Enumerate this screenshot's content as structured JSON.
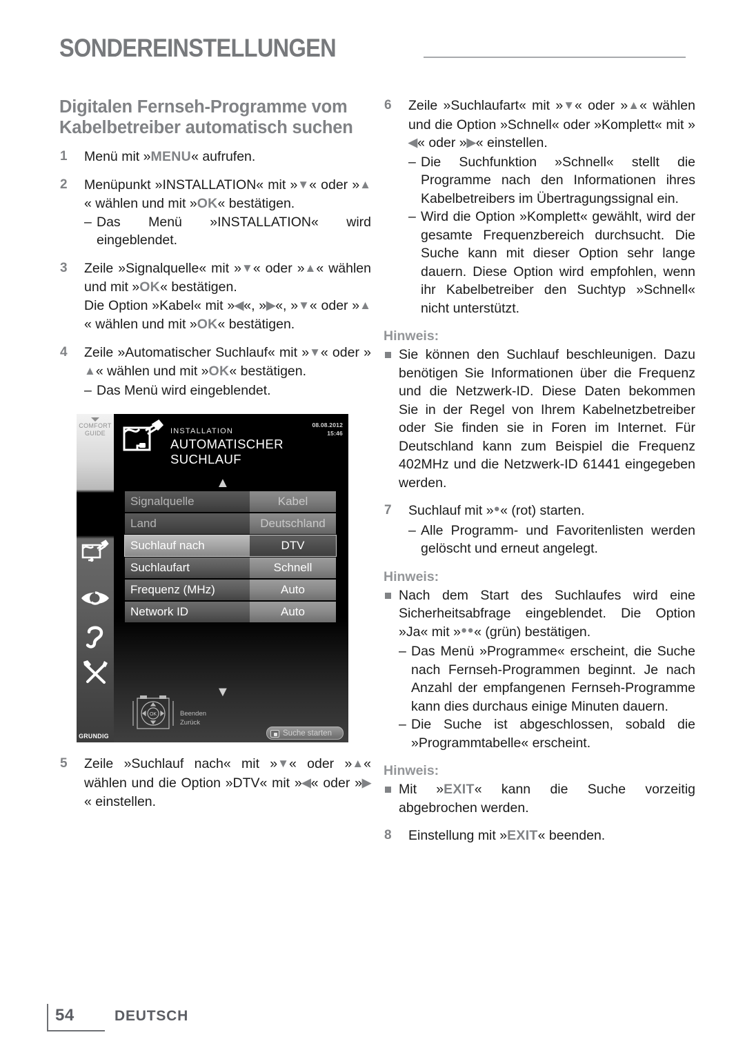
{
  "header": {
    "title": "SONDEREINSTELLUNGEN"
  },
  "left": {
    "section_title": "Digitalen Fernseh-Programme vom Kabelbetreiber automatisch suchen",
    "step1": {
      "num": "1",
      "a": "Menü mit »",
      "key": "MENU",
      "b": "« aufrufen."
    },
    "step2": {
      "num": "2",
      "a": "Menüpunkt »INSTALLATION« mit »",
      "g1": "▼",
      "b": "« oder »",
      "g2": "▲",
      "c": "« wählen und mit »",
      "key": "OK",
      "d": "« bestätigen.",
      "dash": "–",
      "sub": "Das Menü »INSTALLATION« wird eingeblendet."
    },
    "step3": {
      "num": "3",
      "a": "Zeile »Signalquelle« mit »",
      "g1": "▼",
      "b": "« oder »",
      "g2": "▲",
      "c": "« wählen und mit »",
      "key1": "OK",
      "d": "« bestätigen.",
      "e": "Die Option »Kabel« mit »",
      "g3": "◀",
      "f": "«, »",
      "g4": "▶",
      "g": "«, »",
      "g5": "▼",
      "h": "« oder »",
      "g6": "▲",
      "i": "« wählen und mit »",
      "key2": "OK",
      "j": "« bestätigen."
    },
    "step4": {
      "num": "4",
      "a": "Zeile »Automatischer Suchlauf« mit »",
      "g1": "▼",
      "b": "« oder »",
      "g2": "▲",
      "c": "« wählen und mit »",
      "key": "OK",
      "d": "« bestätigen.",
      "dash": "–",
      "sub": "Das Menü wird eingeblendet."
    },
    "step5": {
      "num": "5",
      "a": "Zeile »Suchlauf nach« mit »",
      "g1": "▼",
      "b": "« oder »",
      "g2": "▲",
      "c": "« wählen und die Option »DTV« mit »",
      "g3": "◀",
      "d": "« oder »",
      "g4": "▶",
      "e": "« einstellen."
    }
  },
  "right": {
    "step6": {
      "num": "6",
      "a": "Zeile »Suchlaufart« mit »",
      "g1": "▼",
      "b": "« oder »",
      "g2": "▲",
      "c": "« wählen und die Option »Schnell« oder »Komplett« mit »",
      "g3": "◀",
      "d": "« oder »",
      "g4": "▶",
      "e": "« einstellen.",
      "dash1": "–",
      "sub1": "Die Suchfunktion »Schnell« stellt die Programme nach den Informationen ihres Kabelbetreibers im Übertragungssignal ein.",
      "dash2": "–",
      "sub2": "Wird die Option »Komplett« gewählt, wird der gesamte Frequenzbereich durchsucht. Die Suche kann mit dieser Option sehr lange dauern. Diese Option wird empfohlen, wenn ihr Kabelbetreiber den Suchtyp »Schnell« nicht unterstützt."
    },
    "hinweis1": {
      "title": "Hinweis:",
      "bullet": "Sie können den Suchlauf beschleunigen. Dazu benötigen Sie Informationen über die Frequenz und die Netzwerk-ID. Diese Daten bekommen Sie in der Regel von Ihrem Kabelnetzbetreiber oder Sie finden sie in Foren im Internet. Für Deutschland kann zum Beispiel die Frequenz 402MHz und die Netzwerk-ID 61441 eingegeben werden."
    },
    "step7": {
      "num": "7",
      "a": "Suchlauf mit »",
      "dot": "●",
      "b": "« (rot) starten.",
      "dash": "–",
      "sub": "Alle Programm- und Favoritenlisten werden gelöscht und erneut angelegt."
    },
    "hinweis2": {
      "title": "Hinweis:",
      "b_a": "Nach dem Start des Suchlaufes wird eine Sicherheitsabfrage eingeblendet. Die Option »Ja« mit »",
      "b_dot": "●●",
      "b_b": "« (grün) bestätigen.",
      "dash1": "–",
      "sub1": "Das Menü »Programme« erscheint, die Suche nach Fernseh-Programmen beginnt. Je nach Anzahl der empfangenen Fernseh-Programme kann dies durchaus einige Minuten dauern.",
      "dash2": "–",
      "sub2": "Die Suche ist abgeschlossen, sobald die »Programmtabelle« erscheint."
    },
    "hinweis3": {
      "title": "Hinweis:",
      "b_a": "Mit »",
      "key": "EXIT",
      "b_b": "« kann die Suche vorzeitig abgebrochen werden."
    },
    "step8": {
      "num": "8",
      "a": "Einstellung mit »",
      "key": "EXIT",
      "b": "« beenden."
    }
  },
  "tv": {
    "comfort_guide": "COMFORT\nGUIDE",
    "brand": "GRUNDIG",
    "menu_path": "INSTALLATION",
    "menu_title": "AUTOMATISCHER SUCHLAUF",
    "date": "08.08.2012",
    "time": "15:46",
    "rows": [
      {
        "label": "Signalquelle",
        "value": "Kabel",
        "state": "dim"
      },
      {
        "label": "Land",
        "value": "Deutschland",
        "state": "dim"
      },
      {
        "label": "Suchlauf nach",
        "value": "DTV",
        "state": "selected"
      },
      {
        "label": "Suchlaufart",
        "value": "Schnell",
        "state": "normal"
      },
      {
        "label": "Frequenz (MHz)",
        "value": "Auto",
        "state": "normal"
      },
      {
        "label": "Network ID",
        "value": "Auto",
        "state": "normal"
      }
    ],
    "nav_exit": "Beenden",
    "nav_back": "Zurück",
    "start_button": "Suche starten",
    "ok_label": "OK"
  },
  "footer": {
    "page": "54",
    "language": "DEUTSCH"
  }
}
